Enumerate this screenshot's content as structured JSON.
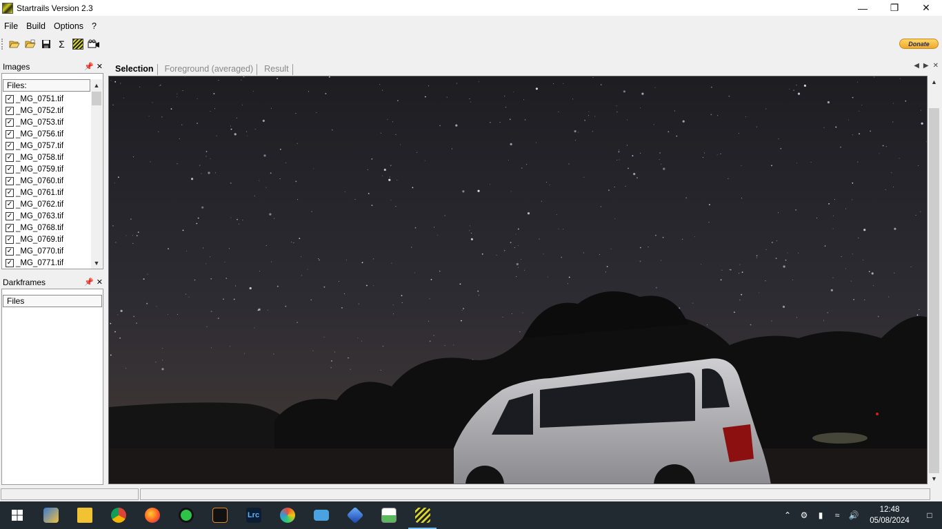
{
  "window": {
    "title": "Startrails Version 2.3"
  },
  "menu": [
    "File",
    "Build",
    "Options",
    "?"
  ],
  "toolbar": {
    "icons": [
      "open-icon",
      "open-folder-icon",
      "save-icon",
      "sum-icon",
      "startrails-icon",
      "video-icon"
    ]
  },
  "donate_label": "Donate",
  "images_panel": {
    "title": "Images",
    "files_header": "Files:",
    "files": [
      "_MG_0751.tif",
      "_MG_0752.tif",
      "_MG_0753.tif",
      "_MG_0756.tif",
      "_MG_0757.tif",
      "_MG_0758.tif",
      "_MG_0759.tif",
      "_MG_0760.tif",
      "_MG_0761.tif",
      "_MG_0762.tif",
      "_MG_0763.tif",
      "_MG_0768.tif",
      "_MG_0769.tif",
      "_MG_0770.tif",
      "_MG_0771.tif"
    ]
  },
  "darkframes_panel": {
    "title": "Darkframes",
    "files_header": "Files"
  },
  "tabs": [
    {
      "label": "Selection",
      "active": true
    },
    {
      "label": "Foreground (averaged)",
      "active": false
    },
    {
      "label": "Result",
      "active": false
    }
  ],
  "taskbar": {
    "apps": [
      "start-icon",
      "network-app-icon",
      "file-explorer-icon",
      "chrome-icon",
      "firefox-icon",
      "app-green-icon",
      "app-curve-icon",
      "lightroom-icon",
      "paint-icon",
      "monitor-icon",
      "cube-app-icon",
      "chart-app-icon",
      "startrails-taskbar-icon"
    ],
    "lightroom_label": "Lrc",
    "time": "12:48",
    "date": "05/08/2024"
  },
  "colors": {
    "taskbar": "#202a30",
    "accent": "#76b9ed"
  }
}
